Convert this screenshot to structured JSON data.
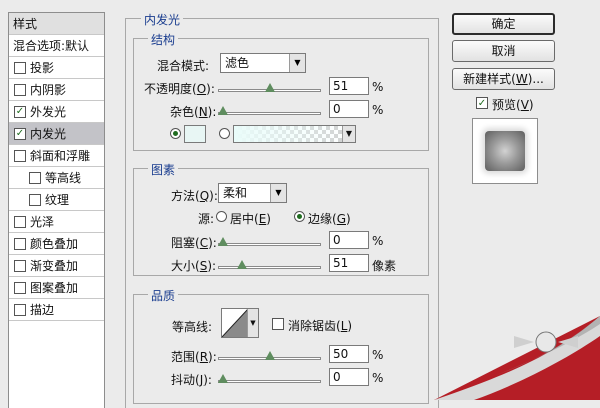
{
  "style_list": {
    "header": "样式",
    "items": [
      {
        "label": "混合选项:默认",
        "checkbox": false,
        "checked": false,
        "indent": false,
        "selected": false
      },
      {
        "label": "投影",
        "checkbox": true,
        "checked": false,
        "indent": false,
        "selected": false
      },
      {
        "label": "内阴影",
        "checkbox": true,
        "checked": false,
        "indent": false,
        "selected": false
      },
      {
        "label": "外发光",
        "checkbox": true,
        "checked": true,
        "indent": false,
        "selected": false
      },
      {
        "label": "内发光",
        "checkbox": true,
        "checked": true,
        "indent": false,
        "selected": true
      },
      {
        "label": "斜面和浮雕",
        "checkbox": true,
        "checked": false,
        "indent": false,
        "selected": false
      },
      {
        "label": "等高线",
        "checkbox": true,
        "checked": false,
        "indent": true,
        "selected": false
      },
      {
        "label": "纹理",
        "checkbox": true,
        "checked": false,
        "indent": true,
        "selected": false
      },
      {
        "label": "光泽",
        "checkbox": true,
        "checked": false,
        "indent": false,
        "selected": false
      },
      {
        "label": "颜色叠加",
        "checkbox": true,
        "checked": false,
        "indent": false,
        "selected": false
      },
      {
        "label": "渐变叠加",
        "checkbox": true,
        "checked": false,
        "indent": false,
        "selected": false
      },
      {
        "label": "图案叠加",
        "checkbox": true,
        "checked": false,
        "indent": false,
        "selected": false
      },
      {
        "label": "描边",
        "checkbox": true,
        "checked": false,
        "indent": false,
        "selected": false
      }
    ]
  },
  "panel": {
    "title": "内发光",
    "structure": {
      "title": "结构",
      "blend_mode": {
        "label": "混合模式:",
        "value": "滤色"
      },
      "opacity": {
        "label": "不透明度(",
        "key": "O",
        "suffix": "):",
        "value": "51",
        "unit": "%",
        "fraction": 0.51
      },
      "noise": {
        "label": "杂色(",
        "key": "N",
        "suffix": "):",
        "value": "0",
        "unit": "%",
        "fraction": 0.0
      },
      "color_swatch": "#e8f6f4",
      "color_mode_solid_selected": true
    },
    "elements": {
      "title": "图素",
      "technique": {
        "label": "方法(",
        "key": "Q",
        "suffix": "):",
        "value": "柔和"
      },
      "source": {
        "label": "源:",
        "center": {
          "label": "居中(",
          "key": "E",
          "suffix": ")",
          "selected": false
        },
        "edge": {
          "label": "边缘(",
          "key": "G",
          "suffix": ")",
          "selected": true
        }
      },
      "choke": {
        "label": "阻塞(",
        "key": "C",
        "suffix": "):",
        "value": "0",
        "unit": "%",
        "fraction": 0.0
      },
      "size": {
        "label": "大小(",
        "key": "S",
        "suffix": "):",
        "value": "51",
        "unit": "像素",
        "fraction": 0.2
      }
    },
    "quality": {
      "title": "品质",
      "contour": {
        "label": "等高线:"
      },
      "anti_alias": {
        "label": "消除锯齿(",
        "key": "L",
        "suffix": ")",
        "checked": false
      },
      "range": {
        "label": "范围(",
        "key": "R",
        "suffix": "):",
        "value": "50",
        "unit": "%",
        "fraction": 0.5
      },
      "jitter": {
        "label": "抖动(",
        "key": "J",
        "suffix": "):",
        "value": "0",
        "unit": "%",
        "fraction": 0.0
      }
    }
  },
  "buttons": {
    "ok": "确定",
    "cancel": "取消",
    "new_style": "新建样式(",
    "new_style_key": "W",
    "new_style_suffix": ")...",
    "preview": {
      "label": "预览(",
      "key": "V",
      "suffix": ")",
      "checked": true
    }
  },
  "icons": {
    "dropdown": "▼"
  },
  "colors": {
    "accent_title": "#1a3d8f",
    "slider_thumb": "#5f8d5f",
    "selected_row": "#c3c3c8",
    "watermark_red": "#c0202a"
  }
}
